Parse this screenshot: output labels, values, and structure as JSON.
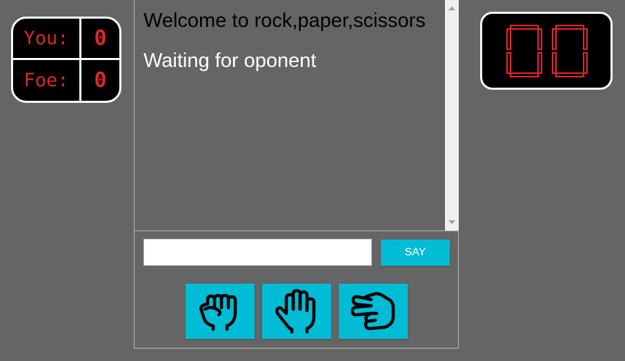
{
  "scoreboard": {
    "you_label": "You:",
    "you_score": "0",
    "foe_label": "Foe:",
    "foe_score": "0"
  },
  "timer": {
    "value": "00",
    "color": "#e0252b"
  },
  "chat": {
    "messages": [
      "Welcome to rock,paper,scissors",
      "Waiting for oponent"
    ],
    "input_value": "",
    "send_label": "SAY"
  },
  "choices": [
    {
      "name": "rock",
      "icon": "fist-icon"
    },
    {
      "name": "paper",
      "icon": "open-hand-icon"
    },
    {
      "name": "scissors",
      "icon": "scissors-hand-icon"
    }
  ],
  "colors": {
    "background": "#656565",
    "accent": "#00bcd4",
    "score_red": "#d8282c"
  }
}
